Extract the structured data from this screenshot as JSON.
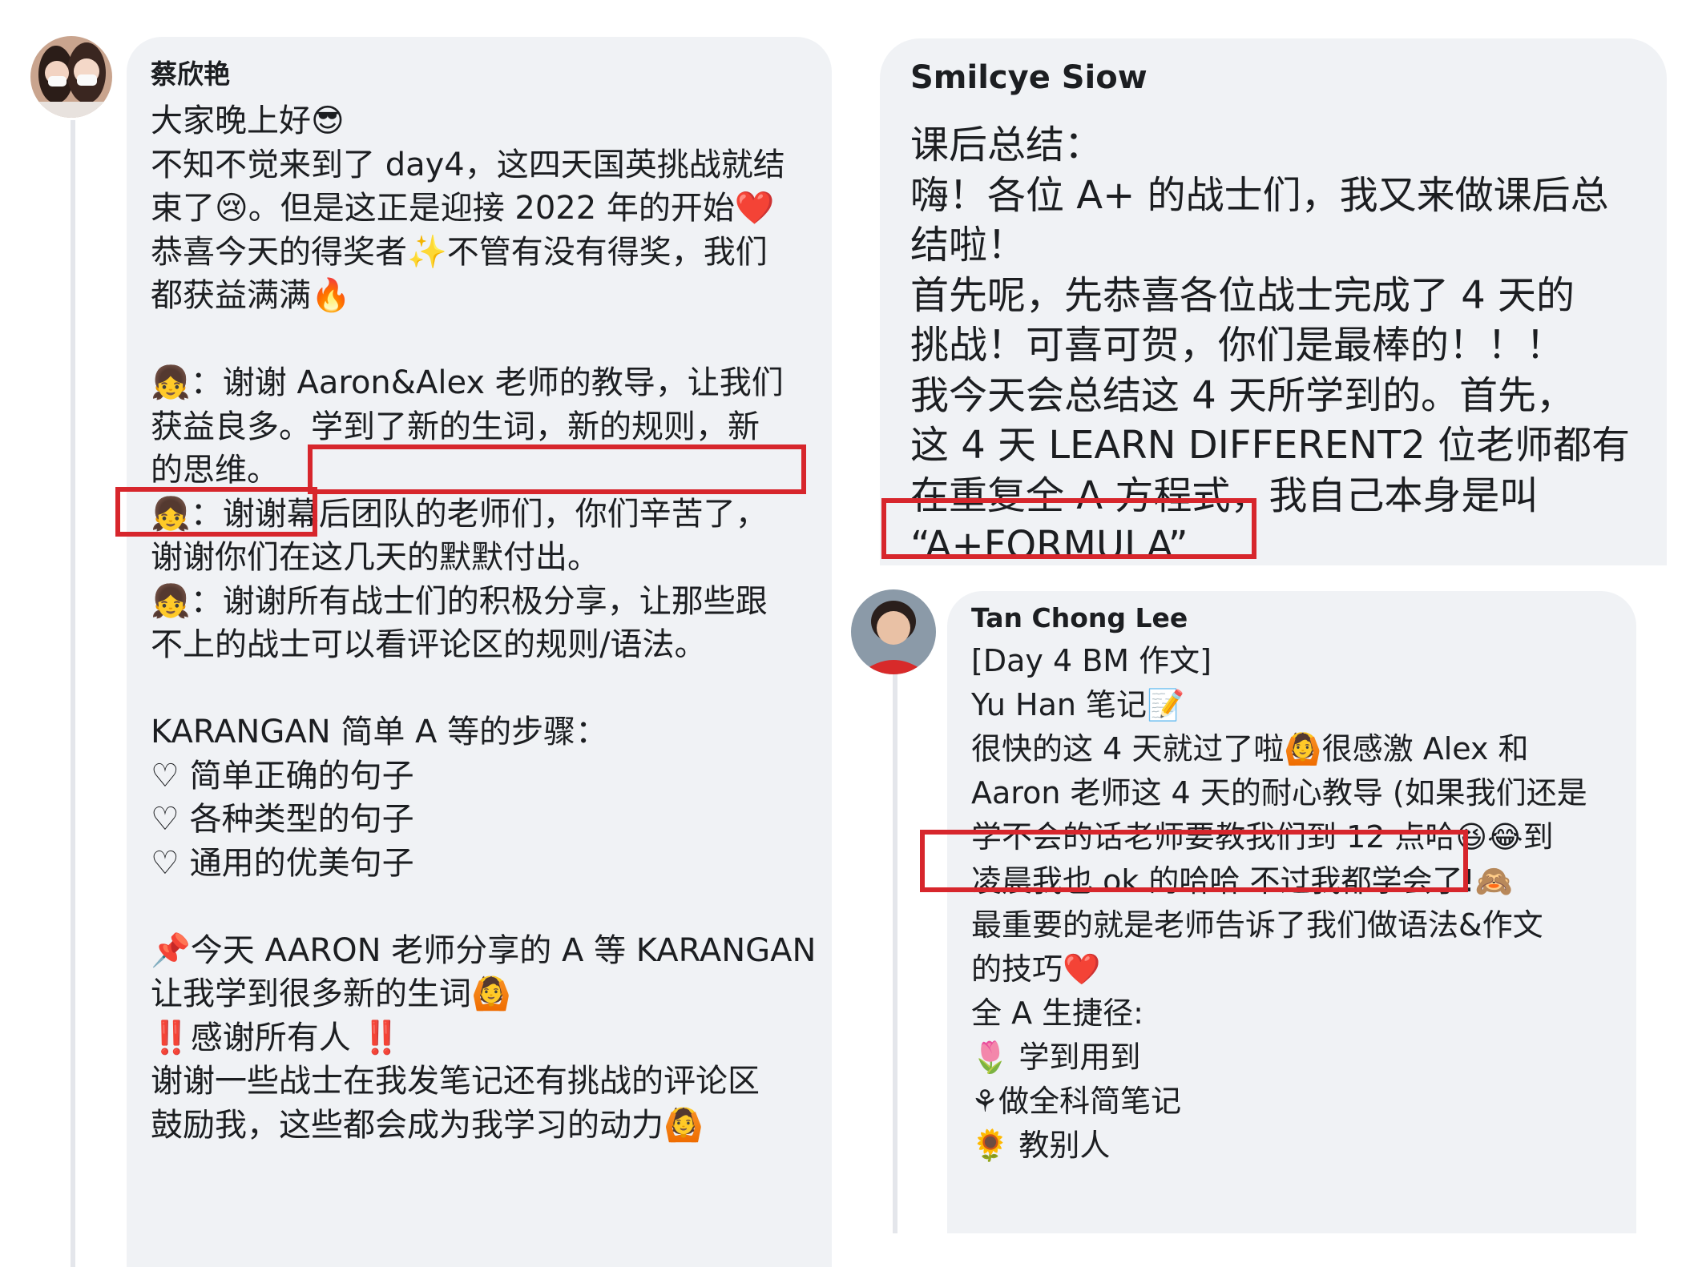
{
  "comments": [
    {
      "author": "蔡欣艳",
      "lines": [
        "大家晚上好😎",
        "不知不觉来到了 day4，这四天国英挑战就结",
        "束了😢。但是这正是迎接 2022 年的开始❤️",
        "恭喜今天的得奖者✨不管有没有得奖，我们",
        "都获益满满🔥",
        "",
        "👧：谢谢 Aaron&Alex 老师的教导，让我们",
        "获益良多。学到了新的生词，新的规则，新",
        "的思维。",
        "👧：谢谢幕后团队的老师们，你们辛苦了，",
        "谢谢你们在这几天的默默付出。",
        "👧：谢谢所有战士们的积极分享，让那些跟",
        "不上的战士可以看评论区的规则/语法。",
        "",
        "KARANGAN 简单 A 等的步骤：",
        "♡ 简单正确的句子",
        "♡ 各种类型的句子",
        "♡ 通用的优美句子",
        "",
        "📌今天 AARON 老师分享的 A 等 KARANGAN",
        "让我学到很多新的生词🙆",
        "‼️感谢所有人 ‼️",
        "谢谢一些战士在我发笔记还有挑战的评论区",
        "鼓励我，这些都会成为我学习的动力🙆"
      ]
    },
    {
      "author": "Smilcye Siow",
      "lines": [
        "课后总结：",
        "嗨！各位 A+ 的战士们，我又来做课后总",
        "结啦！",
        "首先呢，先恭喜各位战士完成了 4 天的",
        "挑战！可喜可贺，你们是最棒的！！！",
        "我今天会总结这 4 天所学到的。首先，",
        "这 4 天 LEARN DIFFERENT2 位老师都有",
        "在重复全 A 方程式，我自己本身是叫",
        "“A+FORMULA”"
      ]
    },
    {
      "author": "Tan Chong Lee",
      "lines": [
        "[Day 4 BM 作文]",
        "Yu Han 笔记📝",
        "很快的这 4 天就过了啦🙆很感激 Alex 和",
        "Aaron 老师这 4 天的耐心教导 (如果我们还是",
        "学不会的话老师要教我们到 12 点哈😆😂到",
        "凌晨我也 ok 的哈哈 不过我都学会了!🙈",
        "最重要的就是老师告诉了我们做语法&作文",
        "的技巧❤️",
        "全 A 生捷径:",
        "🌷 学到用到",
        "⚘做全科简笔记",
        "🌻 教别人"
      ]
    }
  ],
  "highlight_color": "#d7262c"
}
